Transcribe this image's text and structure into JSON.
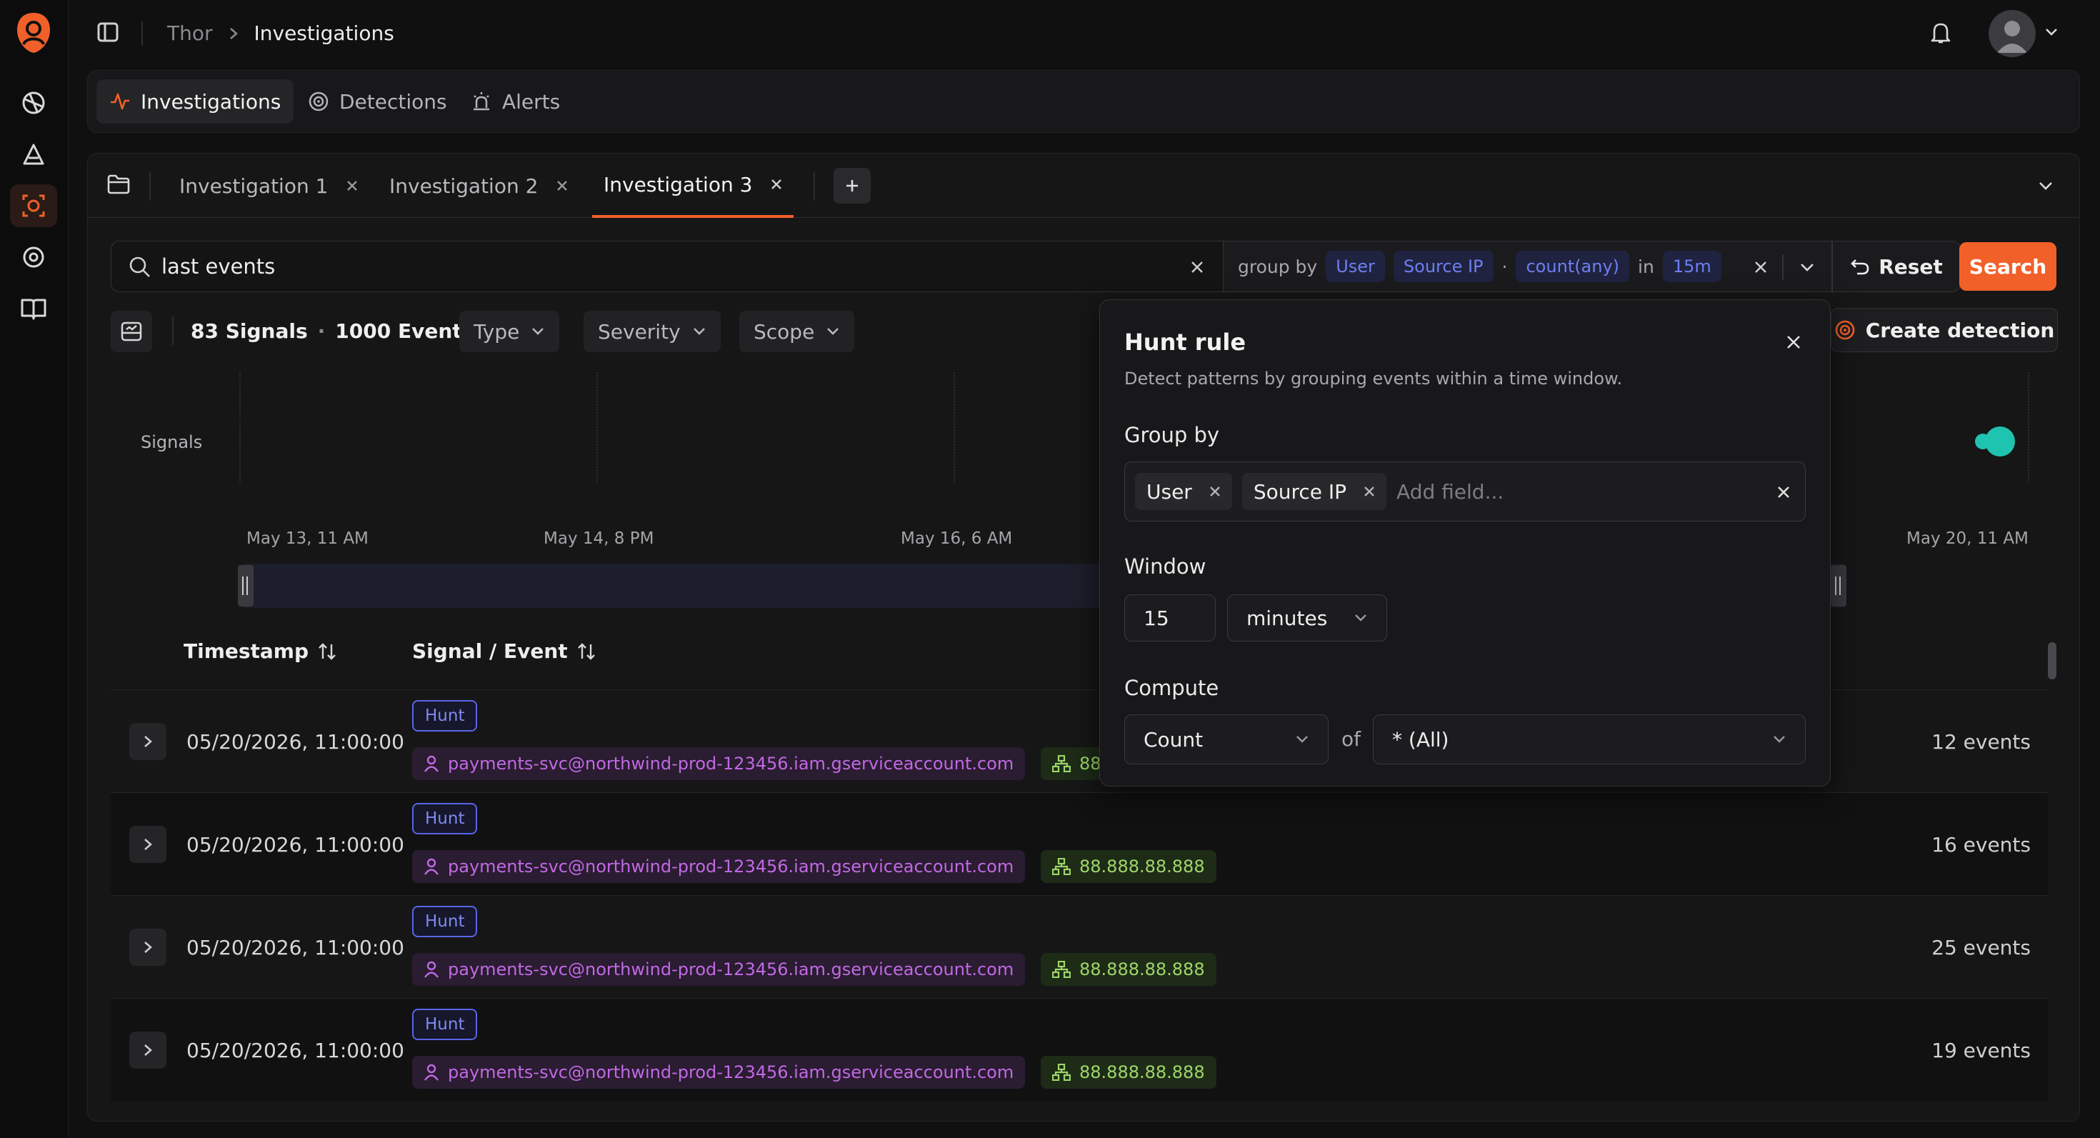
{
  "breadcrumb": {
    "root": "Thor",
    "current": "Investigations"
  },
  "nav_tabs": [
    {
      "label": "Investigations",
      "active": true
    },
    {
      "label": "Detections",
      "active": false
    },
    {
      "label": "Alerts",
      "active": false
    }
  ],
  "investigation_tabs": [
    {
      "label": "Investigation 1",
      "active": false
    },
    {
      "label": "Investigation 2",
      "active": false
    },
    {
      "label": "Investigation 3",
      "active": true
    }
  ],
  "search": {
    "value": "last events",
    "group_by_label": "group by",
    "group_fields": [
      "User",
      "Source IP"
    ],
    "separator": "·",
    "compute": "count(any)",
    "in_label": "in",
    "window": "15m",
    "reset_label": "Reset",
    "search_label": "Search"
  },
  "summary": {
    "signals": "83 Signals",
    "dot": "·",
    "events": "1000 Events"
  },
  "filters": {
    "type": "Type",
    "severity": "Severity",
    "scope": "Scope"
  },
  "create_detection_label": "Create detection",
  "timeline": {
    "row_label": "Signals",
    "ticks": [
      "May 13, 11 AM",
      "May 14, 8 PM",
      "May 16, 6 AM",
      "May 20, 11 AM"
    ]
  },
  "table": {
    "columns": {
      "timestamp": "Timestamp",
      "signal": "Signal / Event"
    },
    "rows": [
      {
        "timestamp": "05/20/2026, 11:00:00",
        "kind": "Hunt",
        "user": "payments-svc@northwind-prod-123456.iam.gserviceaccount.com",
        "ip": "88.888.88.888",
        "count": "12 events"
      },
      {
        "timestamp": "05/20/2026, 11:00:00",
        "kind": "Hunt",
        "user": "payments-svc@northwind-prod-123456.iam.gserviceaccount.com",
        "ip": "88.888.88.888",
        "count": "16 events"
      },
      {
        "timestamp": "05/20/2026, 11:00:00",
        "kind": "Hunt",
        "user": "payments-svc@northwind-prod-123456.iam.gserviceaccount.com",
        "ip": "88.888.88.888",
        "count": "25 events"
      },
      {
        "timestamp": "05/20/2026, 11:00:00",
        "kind": "Hunt",
        "user": "payments-svc@northwind-prod-123456.iam.gserviceaccount.com",
        "ip": "88.888.88.888",
        "count": "19 events"
      }
    ]
  },
  "hunt_rule": {
    "title": "Hunt rule",
    "description": "Detect patterns by grouping events within a time window.",
    "group_by_label": "Group by",
    "group_fields": [
      "User",
      "Source IP"
    ],
    "add_field_placeholder": "Add field...",
    "window_label": "Window",
    "window_value": "15",
    "window_unit": "minutes",
    "compute_label": "Compute",
    "compute_fn": "Count",
    "of_label": "of",
    "compute_field": "* (All)"
  },
  "colors": {
    "accent": "#f2602a",
    "hunt": "#5865e8",
    "user": "#c169e4",
    "ip": "#9fd66a",
    "signal": "#1fc4b0"
  }
}
